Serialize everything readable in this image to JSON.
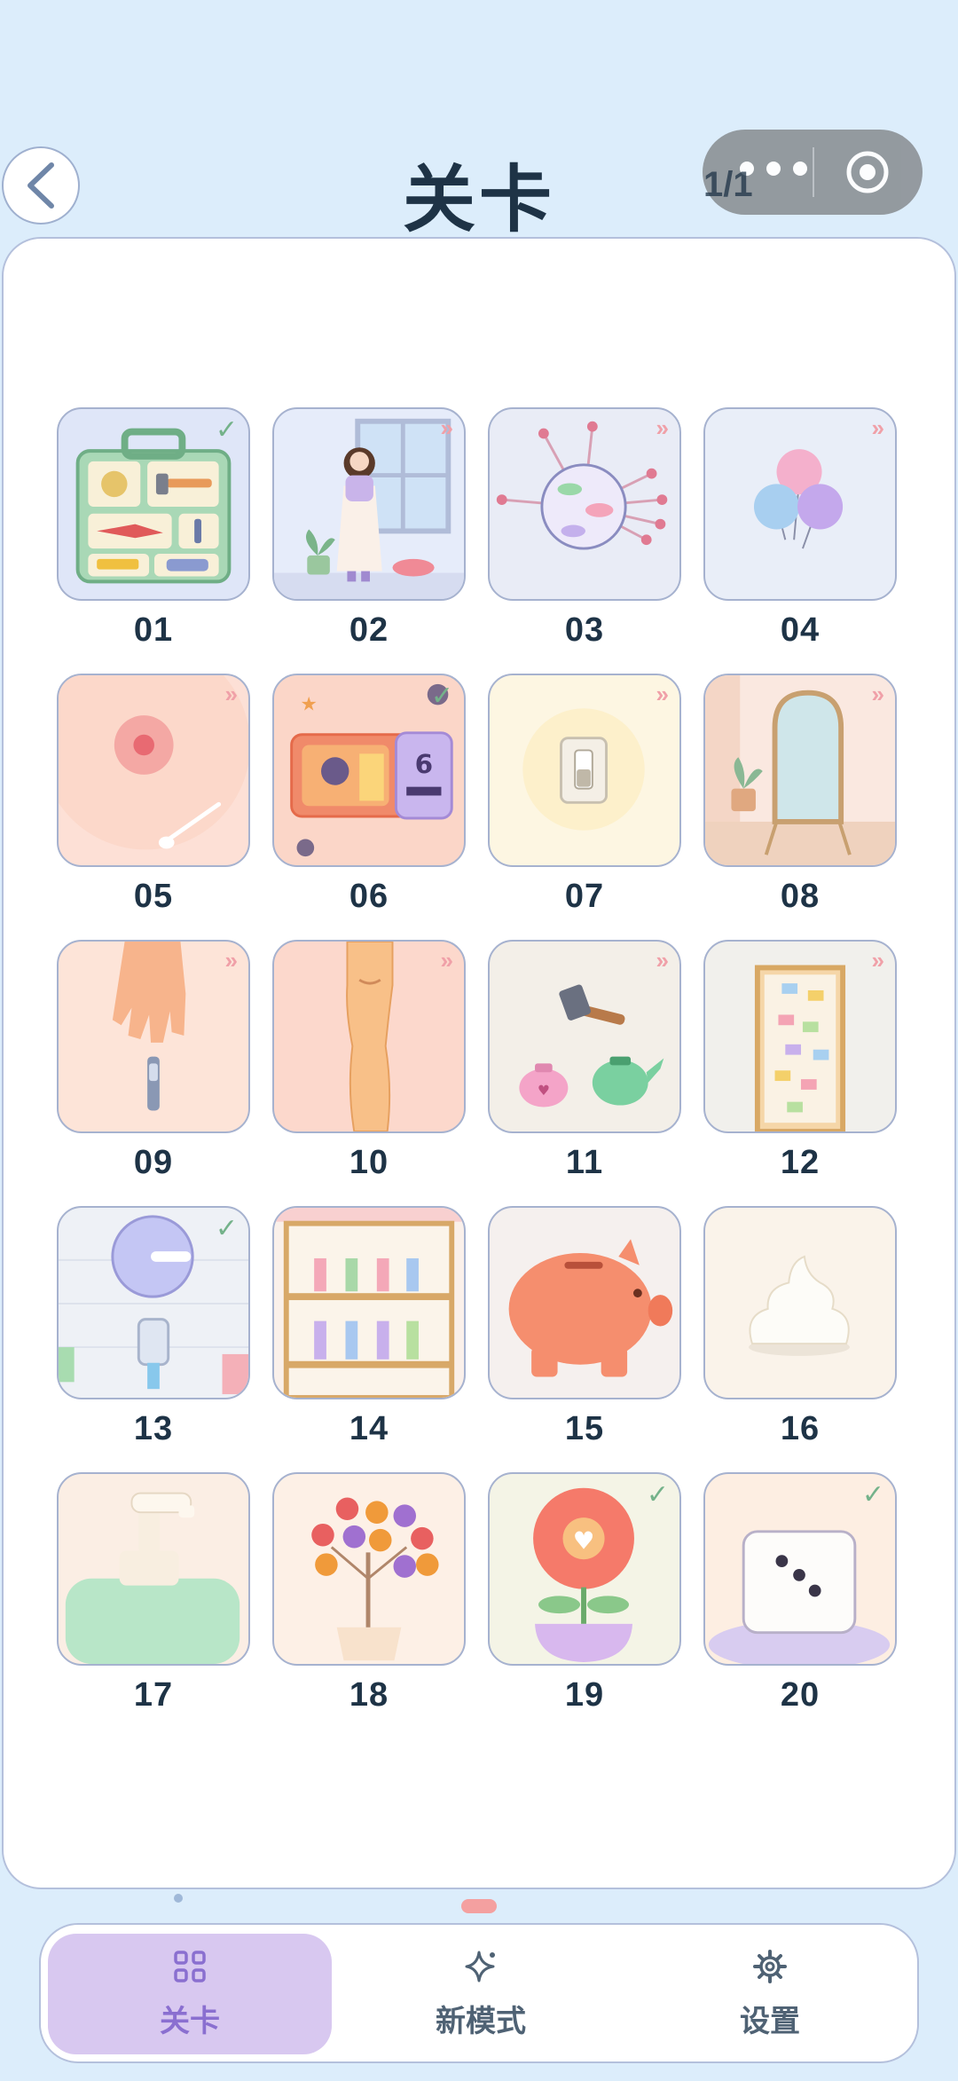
{
  "header": {
    "title": "关卡",
    "page_indicator": "1/1"
  },
  "colors": {
    "background": "#dcedfb",
    "accent": "#8a6fd0",
    "active_tab_bg": "#d8c8f0",
    "done": "#74b28a",
    "next": "#f0a0a8"
  },
  "levels": [
    {
      "num": "01",
      "status": "done",
      "icon": "toolbox-icon"
    },
    {
      "num": "02",
      "status": "next",
      "icon": "girl-window-icon"
    },
    {
      "num": "03",
      "status": "next",
      "icon": "virus-ball-icon"
    },
    {
      "num": "04",
      "status": "next",
      "icon": "balloons-icon"
    },
    {
      "num": "05",
      "status": "next",
      "icon": "peach-spoon-icon"
    },
    {
      "num": "06",
      "status": "done",
      "icon": "movie-ticket-icon"
    },
    {
      "num": "07",
      "status": "next",
      "icon": "light-switch-icon"
    },
    {
      "num": "08",
      "status": "next",
      "icon": "mirror-icon"
    },
    {
      "num": "09",
      "status": "next",
      "icon": "hand-nail-clipper-icon"
    },
    {
      "num": "10",
      "status": "next",
      "icon": "leg-icon"
    },
    {
      "num": "11",
      "status": "next",
      "icon": "hammer-teapot-icon"
    },
    {
      "num": "12",
      "status": "next",
      "icon": "sticky-notes-door-icon"
    },
    {
      "num": "13",
      "status": "done",
      "icon": "faucet-icon"
    },
    {
      "num": "14",
      "status": "none",
      "icon": "bookshelf-icon"
    },
    {
      "num": "15",
      "status": "none",
      "icon": "piggy-bank-icon"
    },
    {
      "num": "16",
      "status": "none",
      "icon": "cream-icon"
    },
    {
      "num": "17",
      "status": "none",
      "icon": "soap-pump-icon"
    },
    {
      "num": "18",
      "status": "none",
      "icon": "fruit-tree-icon"
    },
    {
      "num": "19",
      "status": "done",
      "icon": "flower-pot-icon"
    },
    {
      "num": "20",
      "status": "done",
      "icon": "dice-icon"
    }
  ],
  "tabs": [
    {
      "label": "关卡",
      "icon": "grid-icon",
      "active": true
    },
    {
      "label": "新模式",
      "icon": "sparkle-icon",
      "active": false
    },
    {
      "label": "设置",
      "icon": "gear-icon",
      "active": false
    }
  ]
}
